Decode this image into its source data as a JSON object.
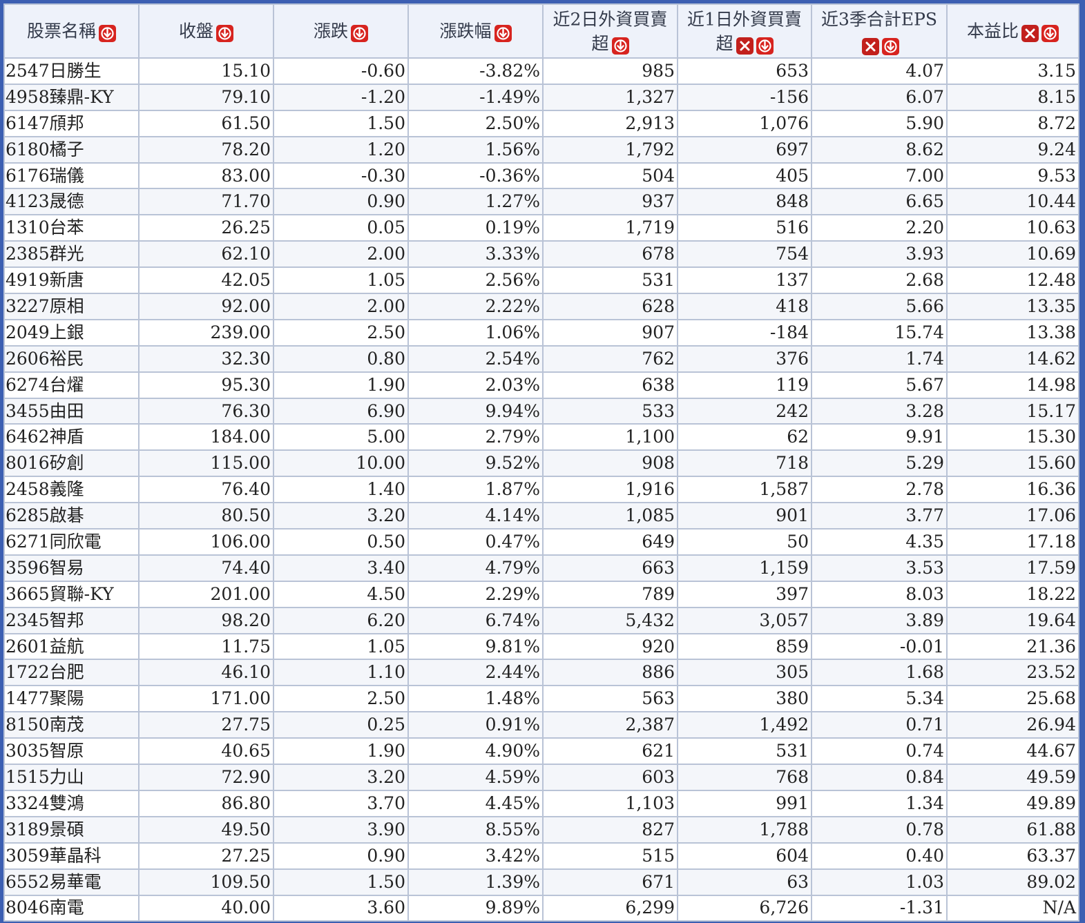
{
  "table": {
    "columns": [
      {
        "label": "股票名稱",
        "sortable": true,
        "clearable": false
      },
      {
        "label": "收盤",
        "sortable": true,
        "clearable": false
      },
      {
        "label": "漲跌",
        "sortable": true,
        "clearable": false
      },
      {
        "label": "漲跌幅",
        "sortable": true,
        "clearable": false
      },
      {
        "label": "近2日外資買賣超",
        "sortable": true,
        "clearable": false
      },
      {
        "label": "近1日外資買賣超",
        "sortable": true,
        "clearable": true
      },
      {
        "label": "近3季合計EPS",
        "sortable": true,
        "clearable": true
      },
      {
        "label": "本益比",
        "sortable": true,
        "clearable": true
      }
    ],
    "rows": [
      [
        "2547日勝生",
        "15.10",
        "-0.60",
        "-3.82%",
        "985",
        "653",
        "4.07",
        "3.15"
      ],
      [
        "4958臻鼎-KY",
        "79.10",
        "-1.20",
        "-1.49%",
        "1,327",
        "-156",
        "6.07",
        "8.15"
      ],
      [
        "6147頎邦",
        "61.50",
        "1.50",
        "2.50%",
        "2,913",
        "1,076",
        "5.90",
        "8.72"
      ],
      [
        "6180橘子",
        "78.20",
        "1.20",
        "1.56%",
        "1,792",
        "697",
        "8.62",
        "9.24"
      ],
      [
        "6176瑞儀",
        "83.00",
        "-0.30",
        "-0.36%",
        "504",
        "405",
        "7.00",
        "9.53"
      ],
      [
        "4123晟德",
        "71.70",
        "0.90",
        "1.27%",
        "937",
        "848",
        "6.65",
        "10.44"
      ],
      [
        "1310台苯",
        "26.25",
        "0.05",
        "0.19%",
        "1,719",
        "516",
        "2.20",
        "10.63"
      ],
      [
        "2385群光",
        "62.10",
        "2.00",
        "3.33%",
        "678",
        "754",
        "3.93",
        "10.69"
      ],
      [
        "4919新唐",
        "42.05",
        "1.05",
        "2.56%",
        "531",
        "137",
        "2.68",
        "12.48"
      ],
      [
        "3227原相",
        "92.00",
        "2.00",
        "2.22%",
        "628",
        "418",
        "5.66",
        "13.35"
      ],
      [
        "2049上銀",
        "239.00",
        "2.50",
        "1.06%",
        "907",
        "-184",
        "15.74",
        "13.38"
      ],
      [
        "2606裕民",
        "32.30",
        "0.80",
        "2.54%",
        "762",
        "376",
        "1.74",
        "14.62"
      ],
      [
        "6274台燿",
        "95.30",
        "1.90",
        "2.03%",
        "638",
        "119",
        "5.67",
        "14.98"
      ],
      [
        "3455由田",
        "76.30",
        "6.90",
        "9.94%",
        "533",
        "242",
        "3.28",
        "15.17"
      ],
      [
        "6462神盾",
        "184.00",
        "5.00",
        "2.79%",
        "1,100",
        "62",
        "9.91",
        "15.30"
      ],
      [
        "8016矽創",
        "115.00",
        "10.00",
        "9.52%",
        "908",
        "718",
        "5.29",
        "15.60"
      ],
      [
        "2458義隆",
        "76.40",
        "1.40",
        "1.87%",
        "1,916",
        "1,587",
        "2.78",
        "16.36"
      ],
      [
        "6285啟碁",
        "80.50",
        "3.20",
        "4.14%",
        "1,085",
        "901",
        "3.77",
        "17.06"
      ],
      [
        "6271同欣電",
        "106.00",
        "0.50",
        "0.47%",
        "649",
        "50",
        "4.35",
        "17.18"
      ],
      [
        "3596智易",
        "74.40",
        "3.40",
        "4.79%",
        "663",
        "1,159",
        "3.53",
        "17.59"
      ],
      [
        "3665貿聯-KY",
        "201.00",
        "4.50",
        "2.29%",
        "789",
        "397",
        "8.03",
        "18.22"
      ],
      [
        "2345智邦",
        "98.20",
        "6.20",
        "6.74%",
        "5,432",
        "3,057",
        "3.89",
        "19.64"
      ],
      [
        "2601益航",
        "11.75",
        "1.05",
        "9.81%",
        "920",
        "859",
        "-0.01",
        "21.36"
      ],
      [
        "1722台肥",
        "46.10",
        "1.10",
        "2.44%",
        "886",
        "305",
        "1.68",
        "23.52"
      ],
      [
        "1477聚陽",
        "171.00",
        "2.50",
        "1.48%",
        "563",
        "380",
        "5.34",
        "25.68"
      ],
      [
        "8150南茂",
        "27.75",
        "0.25",
        "0.91%",
        "2,387",
        "1,492",
        "0.71",
        "26.94"
      ],
      [
        "3035智原",
        "40.65",
        "1.90",
        "4.90%",
        "621",
        "531",
        "0.74",
        "44.67"
      ],
      [
        "1515力山",
        "72.90",
        "3.20",
        "4.59%",
        "603",
        "768",
        "0.84",
        "49.59"
      ],
      [
        "3324雙鴻",
        "86.80",
        "3.70",
        "4.45%",
        "1,103",
        "991",
        "1.34",
        "49.89"
      ],
      [
        "3189景碩",
        "49.50",
        "3.90",
        "8.55%",
        "827",
        "1,788",
        "0.78",
        "61.88"
      ],
      [
        "3059華晶科",
        "27.25",
        "0.90",
        "3.42%",
        "515",
        "604",
        "0.40",
        "63.37"
      ],
      [
        "6552易華電",
        "109.50",
        "1.50",
        "1.39%",
        "671",
        "63",
        "1.03",
        "89.02"
      ],
      [
        "8046南電",
        "40.00",
        "3.60",
        "9.89%",
        "6,299",
        "6,726",
        "-1.31",
        "N/A"
      ]
    ]
  },
  "icons": {
    "sort": "sort-down-icon",
    "clear": "clear-filter-icon"
  },
  "colors": {
    "frame_border": "#3c5fb2",
    "header_bg": "#eef2fa",
    "cell_border": "#b9c3d6",
    "positive": "#d61f1f",
    "negative_change": "#2b8a2b",
    "negative_value": "#d61f1f",
    "icon_red": "#d7241f"
  }
}
